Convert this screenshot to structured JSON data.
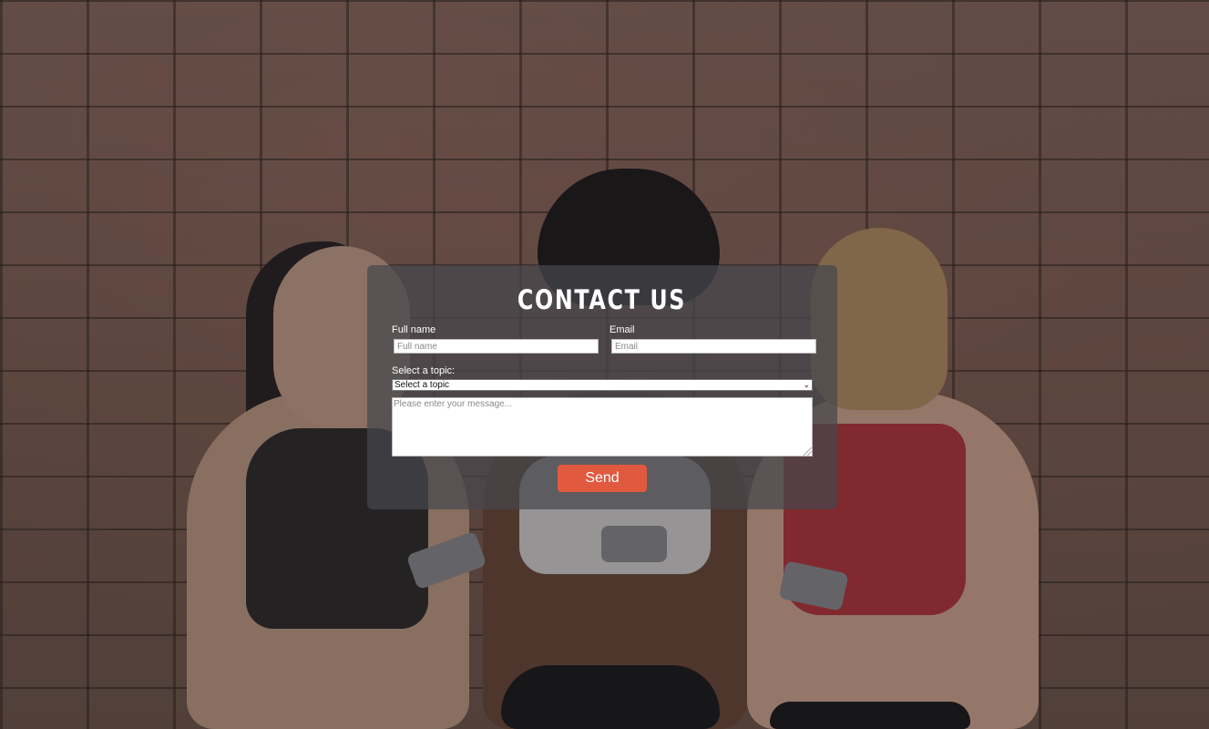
{
  "contact": {
    "title": "CONTACT US",
    "fullname": {
      "label": "Full name",
      "placeholder": "Full name",
      "value": ""
    },
    "email": {
      "label": "Email",
      "placeholder": "Email",
      "value": ""
    },
    "topic": {
      "label": "Select a topic:",
      "selected": "Select a topic"
    },
    "message": {
      "placeholder": "Please enter your message...",
      "value": ""
    },
    "send_label": "Send"
  },
  "colors": {
    "button": "#e15a40",
    "panel": "#46464c",
    "text": "#ffffff"
  },
  "icons": {
    "select_chevron": "chevron-down-icon",
    "textarea_grip": "resize-grip-icon"
  }
}
